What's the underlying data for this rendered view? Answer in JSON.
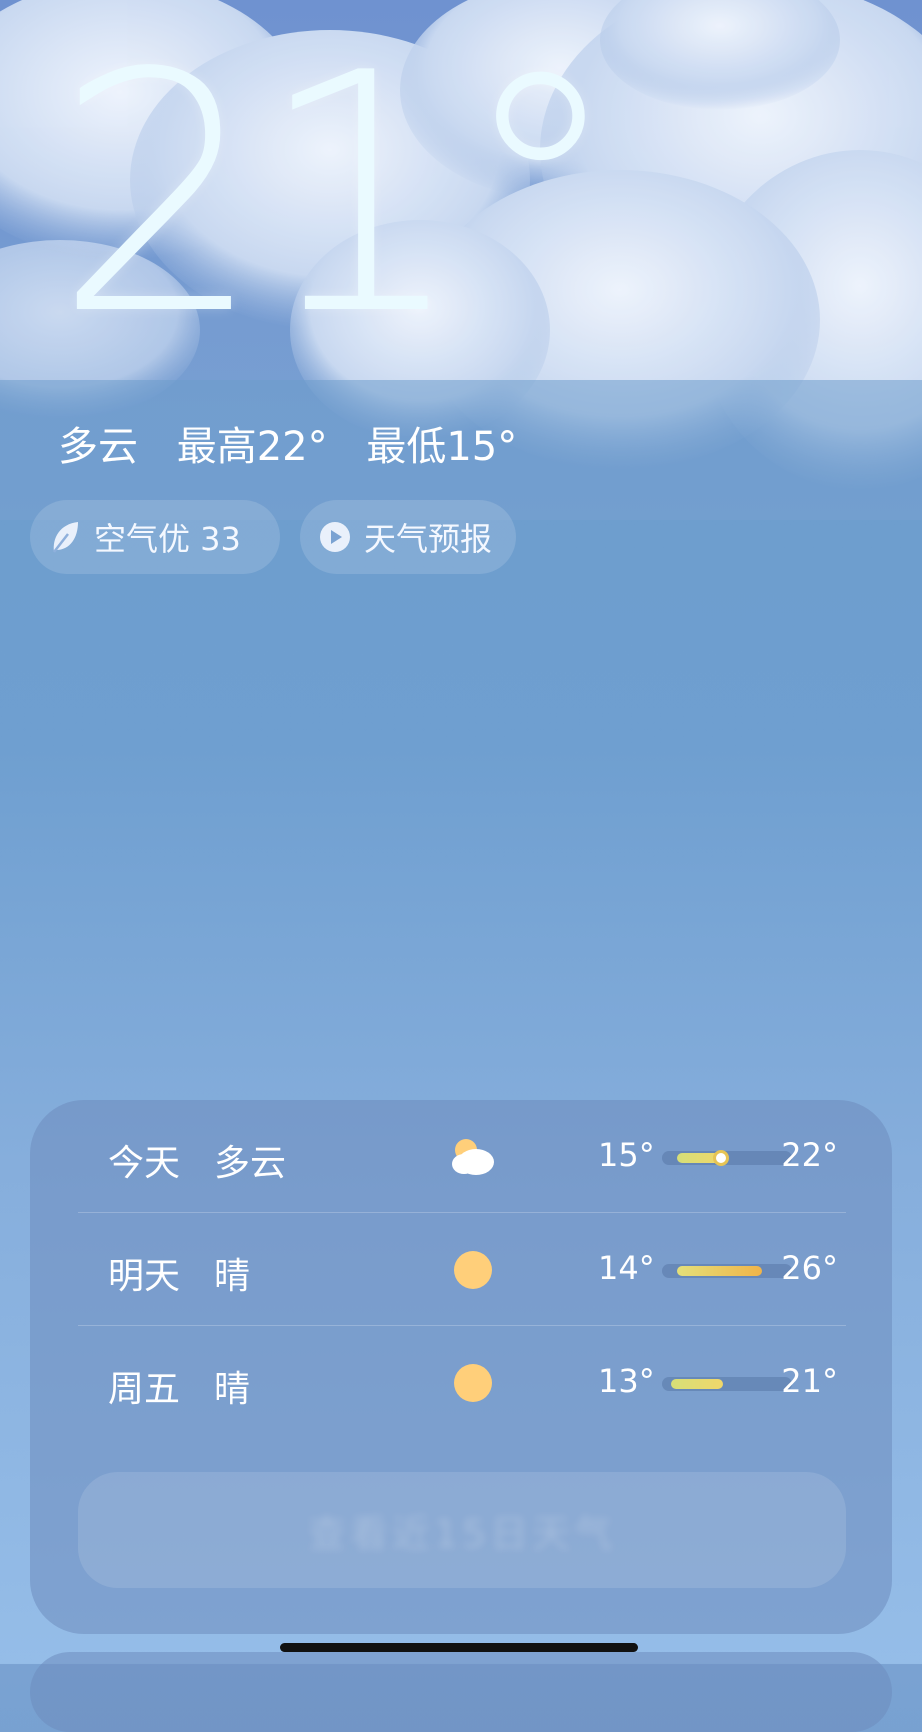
{
  "header": {
    "location_line": "",
    "temperature": "21°",
    "condition": "多云",
    "high": "最高22°",
    "low": "最低15°"
  },
  "chips": {
    "air_quality": "空气优 33",
    "forecast": "天气预报"
  },
  "forecast": {
    "days": [
      {
        "day": "今天",
        "condition": "多云",
        "icon": "partly-cloudy-icon",
        "low": "15°",
        "high": "22°",
        "range_start": 0.1,
        "range_end": 0.45,
        "current_marker": 0.45
      },
      {
        "day": "明天",
        "condition": "晴",
        "icon": "sun-icon",
        "low": "14°",
        "high": "26°",
        "range_start": 0.1,
        "range_end": 0.75
      },
      {
        "day": "周五",
        "condition": "晴",
        "icon": "sun-icon",
        "low": "13°",
        "high": "21°",
        "range_start": 0.05,
        "range_end": 0.45
      }
    ],
    "more_button": "查看近15日天气"
  },
  "colors": {
    "sky_top": "#7aa2d2",
    "sky_bottom": "#95bde8",
    "bar_warm": "#f0b449",
    "bar_mild": "#d9e07a",
    "sun": "#ffcf7a"
  }
}
